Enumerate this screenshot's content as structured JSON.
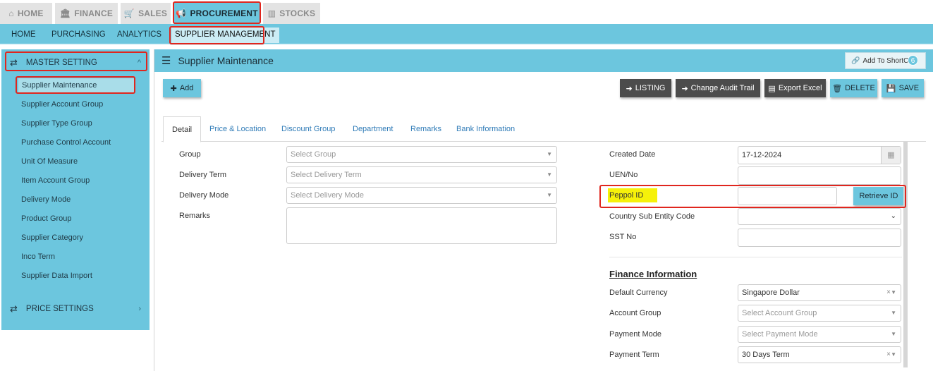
{
  "top_tabs": [
    {
      "label": "HOME",
      "icon": "home-icon"
    },
    {
      "label": "FINANCE",
      "icon": "bank-icon"
    },
    {
      "label": "SALES",
      "icon": "cart-icon"
    },
    {
      "label": "PROCUREMENT",
      "icon": "megaphone-icon"
    },
    {
      "label": "STOCKS",
      "icon": "bar-chart-icon"
    }
  ],
  "submenu": [
    "HOME",
    "PURCHASING",
    "ANALYTICS",
    "SUPPLIER MANAGEMENT"
  ],
  "sidebar": {
    "master_setting": "MASTER SETTING",
    "items": [
      "Supplier Maintenance",
      "Supplier Account Group",
      "Supplier Type Group",
      "Purchase Control Account",
      "Unit Of Measure",
      "Item Account Group",
      "Delivery Mode",
      "Product Group",
      "Supplier Category",
      "Inco Term",
      "Supplier Data Import"
    ],
    "price_settings": "PRICE SETTINGS"
  },
  "panel": {
    "title": "Supplier Maintenance",
    "shortcut": "Add To ShortCut",
    "shortcut_count": "6"
  },
  "toolbar": {
    "add": "Add",
    "listing": "LISTING",
    "audit": "Change Audit Trail",
    "export": "Export Excel",
    "delete": "DELETE",
    "save": "SAVE"
  },
  "tabs": [
    "Detail",
    "Price & Location",
    "Discount Group",
    "Department",
    "Remarks",
    "Bank Information"
  ],
  "left_form": {
    "group_label": "Group",
    "group_placeholder": "Select Group",
    "delivery_term_label": "Delivery Term",
    "delivery_term_placeholder": "Select Delivery Term",
    "delivery_mode_label": "Delivery Mode",
    "delivery_mode_placeholder": "Select Delivery Mode",
    "remarks_label": "Remarks"
  },
  "right_form": {
    "created_date_label": "Created Date",
    "created_date": "17-12-2024",
    "uen_label": "UEN/No",
    "peppol_label": "Peppol ID",
    "retrieve_button": "Retrieve ID",
    "country_sub_label": "Country Sub Entity Code",
    "sst_label": "SST No"
  },
  "finance": {
    "title": "Finance Information",
    "currency_label": "Default Currency",
    "currency": "Singapore Dollar",
    "account_group_label": "Account Group",
    "account_group_placeholder": "Select Account Group",
    "payment_mode_label": "Payment Mode",
    "payment_mode_placeholder": "Select Payment Mode",
    "payment_term_label": "Payment Term",
    "payment_term": "30 Days Term"
  },
  "colors": {
    "accent": "#6cc6de",
    "highlight_border": "#e0261e",
    "highlight_fill": "#f6f10a",
    "dark_button": "#4c4c4c"
  }
}
